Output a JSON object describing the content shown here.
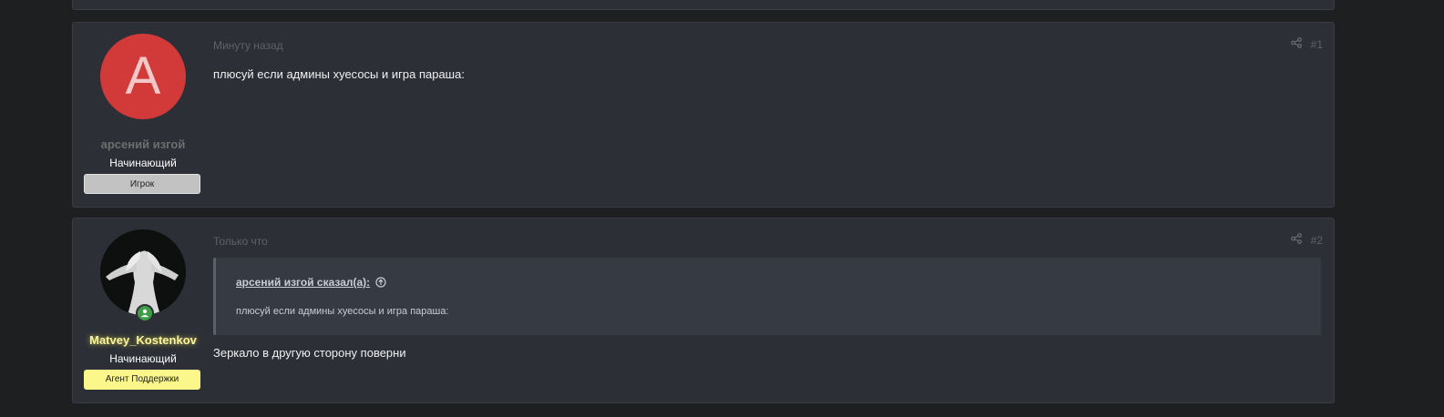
{
  "posts": [
    {
      "avatar_letter": "A",
      "username": "арсений изгой",
      "rank": "Начинающий",
      "badge": "Игрок",
      "time": "Минуту назад",
      "number": "#1",
      "body": "плюсуй если админы хуесосы и игра параша:"
    },
    {
      "username": "Matvey_Kostenkov",
      "rank": "Начинающий",
      "badge": "Агент Поддержки",
      "time": "Только что",
      "number": "#2",
      "quote": {
        "author_line": "арсений изгой сказал(а):",
        "text": "плюсуй если админы хуесосы и игра параша:"
      },
      "body": "Зеркало в другую сторону поверни"
    }
  ],
  "colors": {
    "background": "#1e1f21",
    "card": "#2c2f36",
    "avatar_red": "#d23a3a",
    "badge_yellow": "#fbf78a",
    "username_yellow": "#f9f49a",
    "online_green": "#3f9d46"
  }
}
